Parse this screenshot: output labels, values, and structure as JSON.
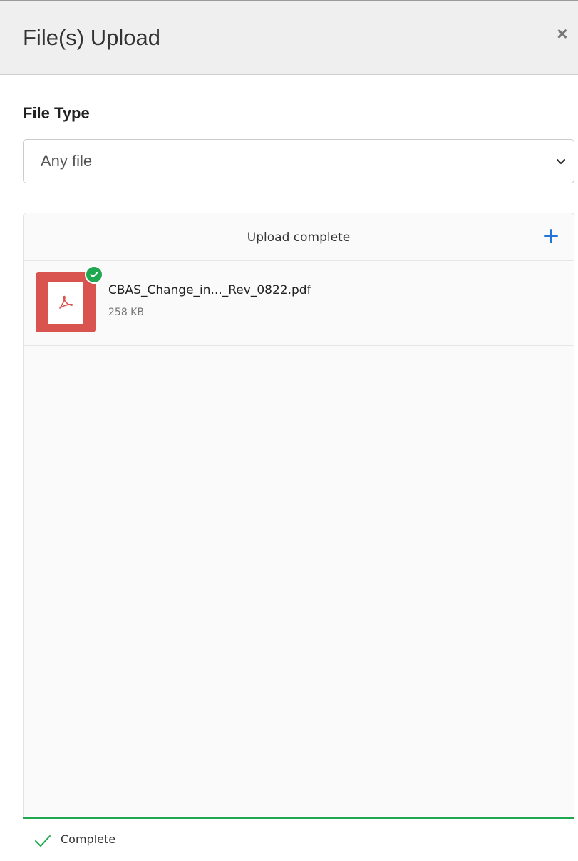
{
  "modal": {
    "title": "File(s) Upload",
    "close_symbol": "×"
  },
  "file_type": {
    "label": "File Type",
    "selected": "Any file"
  },
  "dashboard": {
    "title": "Upload complete",
    "add_icon": "plus-icon",
    "files": [
      {
        "name": "CBAS_Change_in..._Rev_0822.pdf",
        "size": "258 KB",
        "type_icon": "pdf-icon",
        "status_icon": "check-circle-icon"
      }
    ]
  },
  "status_bar": {
    "text": "Complete",
    "icon": "checkmark-icon"
  },
  "colors": {
    "accent": "#1fa84f",
    "pdf": "#d9534f",
    "plus": "#2275d7"
  }
}
